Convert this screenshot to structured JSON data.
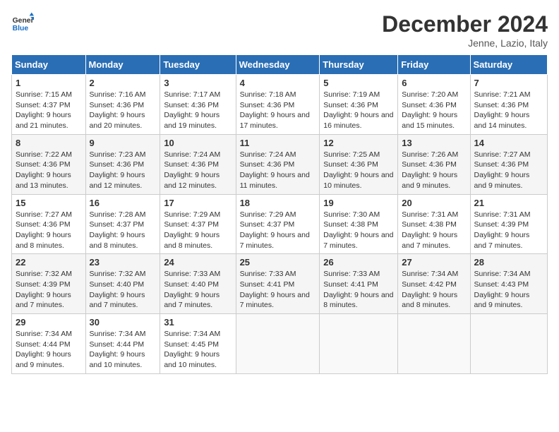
{
  "header": {
    "logo_general": "General",
    "logo_blue": "Blue",
    "title": "December 2024",
    "subtitle": "Jenne, Lazio, Italy"
  },
  "columns": [
    "Sunday",
    "Monday",
    "Tuesday",
    "Wednesday",
    "Thursday",
    "Friday",
    "Saturday"
  ],
  "weeks": [
    [
      {
        "day": "1",
        "sunrise": "7:15 AM",
        "sunset": "4:37 PM",
        "daylight": "9 hours and 21 minutes."
      },
      {
        "day": "2",
        "sunrise": "7:16 AM",
        "sunset": "4:36 PM",
        "daylight": "9 hours and 20 minutes."
      },
      {
        "day": "3",
        "sunrise": "7:17 AM",
        "sunset": "4:36 PM",
        "daylight": "9 hours and 19 minutes."
      },
      {
        "day": "4",
        "sunrise": "7:18 AM",
        "sunset": "4:36 PM",
        "daylight": "9 hours and 17 minutes."
      },
      {
        "day": "5",
        "sunrise": "7:19 AM",
        "sunset": "4:36 PM",
        "daylight": "9 hours and 16 minutes."
      },
      {
        "day": "6",
        "sunrise": "7:20 AM",
        "sunset": "4:36 PM",
        "daylight": "9 hours and 15 minutes."
      },
      {
        "day": "7",
        "sunrise": "7:21 AM",
        "sunset": "4:36 PM",
        "daylight": "9 hours and 14 minutes."
      }
    ],
    [
      {
        "day": "8",
        "sunrise": "7:22 AM",
        "sunset": "4:36 PM",
        "daylight": "9 hours and 13 minutes."
      },
      {
        "day": "9",
        "sunrise": "7:23 AM",
        "sunset": "4:36 PM",
        "daylight": "9 hours and 12 minutes."
      },
      {
        "day": "10",
        "sunrise": "7:24 AM",
        "sunset": "4:36 PM",
        "daylight": "9 hours and 12 minutes."
      },
      {
        "day": "11",
        "sunrise": "7:24 AM",
        "sunset": "4:36 PM",
        "daylight": "9 hours and 11 minutes."
      },
      {
        "day": "12",
        "sunrise": "7:25 AM",
        "sunset": "4:36 PM",
        "daylight": "9 hours and 10 minutes."
      },
      {
        "day": "13",
        "sunrise": "7:26 AM",
        "sunset": "4:36 PM",
        "daylight": "9 hours and 9 minutes."
      },
      {
        "day": "14",
        "sunrise": "7:27 AM",
        "sunset": "4:36 PM",
        "daylight": "9 hours and 9 minutes."
      }
    ],
    [
      {
        "day": "15",
        "sunrise": "7:27 AM",
        "sunset": "4:36 PM",
        "daylight": "9 hours and 8 minutes."
      },
      {
        "day": "16",
        "sunrise": "7:28 AM",
        "sunset": "4:37 PM",
        "daylight": "9 hours and 8 minutes."
      },
      {
        "day": "17",
        "sunrise": "7:29 AM",
        "sunset": "4:37 PM",
        "daylight": "9 hours and 8 minutes."
      },
      {
        "day": "18",
        "sunrise": "7:29 AM",
        "sunset": "4:37 PM",
        "daylight": "9 hours and 7 minutes."
      },
      {
        "day": "19",
        "sunrise": "7:30 AM",
        "sunset": "4:38 PM",
        "daylight": "9 hours and 7 minutes."
      },
      {
        "day": "20",
        "sunrise": "7:31 AM",
        "sunset": "4:38 PM",
        "daylight": "9 hours and 7 minutes."
      },
      {
        "day": "21",
        "sunrise": "7:31 AM",
        "sunset": "4:39 PM",
        "daylight": "9 hours and 7 minutes."
      }
    ],
    [
      {
        "day": "22",
        "sunrise": "7:32 AM",
        "sunset": "4:39 PM",
        "daylight": "9 hours and 7 minutes."
      },
      {
        "day": "23",
        "sunrise": "7:32 AM",
        "sunset": "4:40 PM",
        "daylight": "9 hours and 7 minutes."
      },
      {
        "day": "24",
        "sunrise": "7:33 AM",
        "sunset": "4:40 PM",
        "daylight": "9 hours and 7 minutes."
      },
      {
        "day": "25",
        "sunrise": "7:33 AM",
        "sunset": "4:41 PM",
        "daylight": "9 hours and 7 minutes."
      },
      {
        "day": "26",
        "sunrise": "7:33 AM",
        "sunset": "4:41 PM",
        "daylight": "9 hours and 8 minutes."
      },
      {
        "day": "27",
        "sunrise": "7:34 AM",
        "sunset": "4:42 PM",
        "daylight": "9 hours and 8 minutes."
      },
      {
        "day": "28",
        "sunrise": "7:34 AM",
        "sunset": "4:43 PM",
        "daylight": "9 hours and 9 minutes."
      }
    ],
    [
      {
        "day": "29",
        "sunrise": "7:34 AM",
        "sunset": "4:44 PM",
        "daylight": "9 hours and 9 minutes."
      },
      {
        "day": "30",
        "sunrise": "7:34 AM",
        "sunset": "4:44 PM",
        "daylight": "9 hours and 10 minutes."
      },
      {
        "day": "31",
        "sunrise": "7:34 AM",
        "sunset": "4:45 PM",
        "daylight": "9 hours and 10 minutes."
      },
      null,
      null,
      null,
      null
    ]
  ],
  "labels": {
    "sunrise": "Sunrise:",
    "sunset": "Sunset:",
    "daylight": "Daylight:"
  }
}
